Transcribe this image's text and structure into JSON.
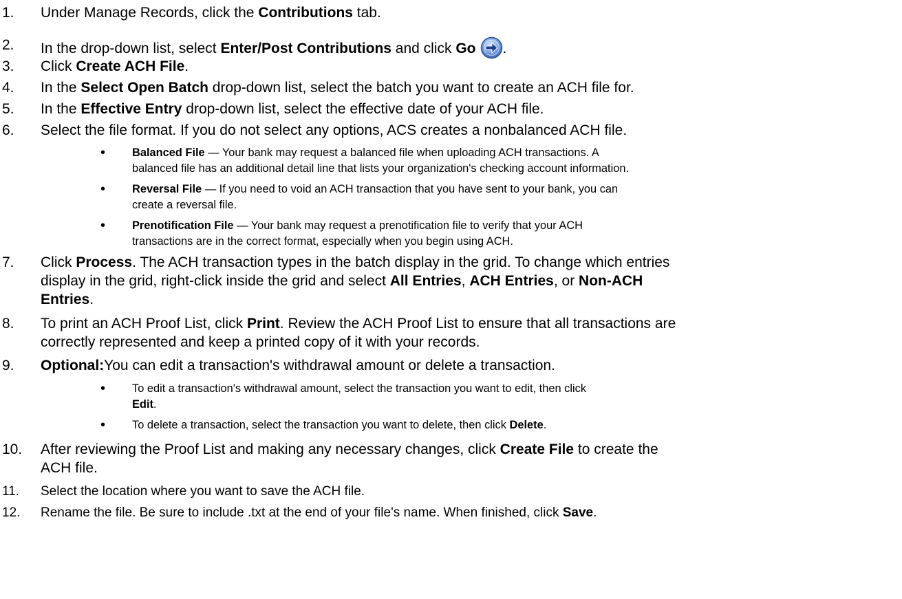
{
  "steps": [
    {
      "number": "1.",
      "parts": [
        "Under Manage Records, click the ",
        "Contributions",
        " tab."
      ]
    },
    {
      "number": "2.",
      "parts": [
        "In the drop-down list, select ",
        "Enter/Post Contributions",
        " and click ",
        "Go",
        "."
      ],
      "icon": "go-arrow-icon"
    },
    {
      "number": "3.",
      "parts": [
        "Click ",
        "Create ACH File",
        "."
      ]
    },
    {
      "number": "4.",
      "parts": [
        "In the ",
        "Select Open Batch",
        " drop-down list, select the batch you want to create an ACH file for."
      ]
    },
    {
      "number": "5.",
      "parts": [
        "In the ",
        "Effective Entry",
        " drop-down list, select the effective date of your ACH file."
      ]
    },
    {
      "number": "6.",
      "parts": [
        "Select the file format. If you do not select any options, ACS creates a nonbalanced ACH file."
      ],
      "bullets": [
        {
          "lines": [
            [
              "Balanced File",
              " — Your bank may request a balanced file when uploading ACH transactions. A"
            ],
            [
              "balanced file has an additional detail line that lists your organization's checking account information."
            ]
          ]
        },
        {
          "lines": [
            [
              "Reversal File",
              " — If you need to void an ACH transaction that you have sent to your bank, you can"
            ],
            [
              "create a reversal file."
            ]
          ]
        },
        {
          "lines": [
            [
              "Prenotification File",
              " — Your bank may request a prenotification file to verify that your ACH"
            ],
            [
              "transactions are in the correct format, especially when you begin using ACH."
            ]
          ]
        }
      ]
    },
    {
      "number": "7.",
      "lines": [
        [
          "Click ",
          "Process",
          ". The ACH transaction types in the batch display in the grid. To change which entries"
        ],
        [
          "display in the grid, right-click inside the grid and select ",
          "All Entries",
          ", ",
          "ACH Entries",
          ", or ",
          "Non-ACH"
        ],
        [
          "Entries",
          "."
        ]
      ]
    },
    {
      "number": "8.",
      "lines": [
        [
          "To print an ACH Proof List, click ",
          "Print",
          ". Review the ACH Proof List to ensure that all transactions are"
        ],
        [
          "correctly represented and keep a printed copy of it with your records."
        ]
      ]
    },
    {
      "number": "9.",
      "parts": [
        "Optional:",
        "You can edit a transaction's withdrawal amount or delete a transaction."
      ],
      "bullets": [
        {
          "lines": [
            [
              "To edit a transaction's withdrawal amount, select the transaction you want to edit, then click"
            ],
            [
              "Edit",
              "."
            ]
          ]
        },
        {
          "lines": [
            [
              "To delete a transaction, select the transaction you want to delete, then click ",
              "Delete",
              "."
            ]
          ]
        }
      ]
    },
    {
      "number": "10.",
      "lines": [
        [
          "After reviewing the Proof List and making any necessary changes, click ",
          "Create File",
          " to create the"
        ],
        [
          "ACH file."
        ]
      ]
    },
    {
      "number": "11.",
      "parts": [
        "Select the location where you want to save the ACH file."
      ]
    },
    {
      "number": "12.",
      "parts": [
        "Rename the file. Be sure to include .txt at the end of your file's name. When finished, click ",
        "Save",
        "."
      ]
    }
  ]
}
